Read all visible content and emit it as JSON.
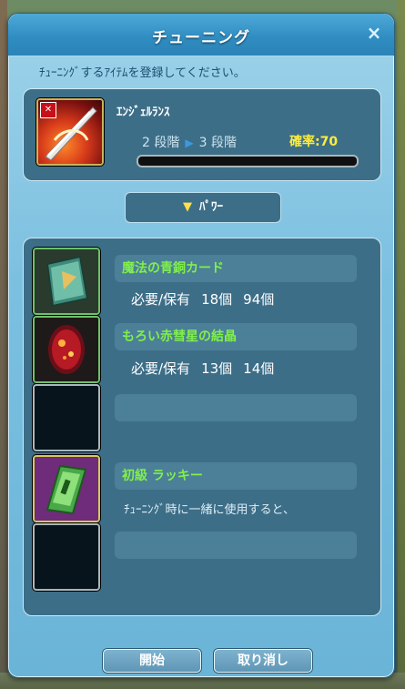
{
  "window": {
    "title": "チューニング",
    "close_label": "×",
    "instruction": "ﾁｭｰﾆﾝｸﾞするｱｲﾃﾑを登録してください。"
  },
  "target": {
    "name": "ｴﾝｼﾞｪﾙﾗﾝｽ",
    "from_stage": "2 段階",
    "arrow": "▶",
    "to_stage": "3 段階",
    "rate": "確率:70",
    "icon": "red-x-mark"
  },
  "power_button": {
    "arrow": "▼",
    "label": "ﾊﾟﾜｰ"
  },
  "materials": [
    {
      "name": "魔法の青銅カード",
      "req_label": "必要/保有",
      "required": "18個",
      "owned": "94個",
      "icon": "bronze-card-icon"
    },
    {
      "name": "もろい赤彗星の結晶",
      "req_label": "必要/保有",
      "required": "13個",
      "owned": "14個",
      "icon": "red-crystal-icon"
    },
    {
      "name": "",
      "empty": true
    },
    {
      "name": "初級 ラッキー",
      "description": "ﾁｭｰﾆﾝｸﾞ時に一緒に使用すると、",
      "icon": "lucky-ticket-icon"
    },
    {
      "name": "",
      "empty": true
    }
  ],
  "buttons": {
    "start": "開始",
    "cancel": "取り消し"
  },
  "colors": {
    "accent_name": "#7ff04a",
    "rate": "#ffee3a",
    "panel": "#3d6e88"
  }
}
